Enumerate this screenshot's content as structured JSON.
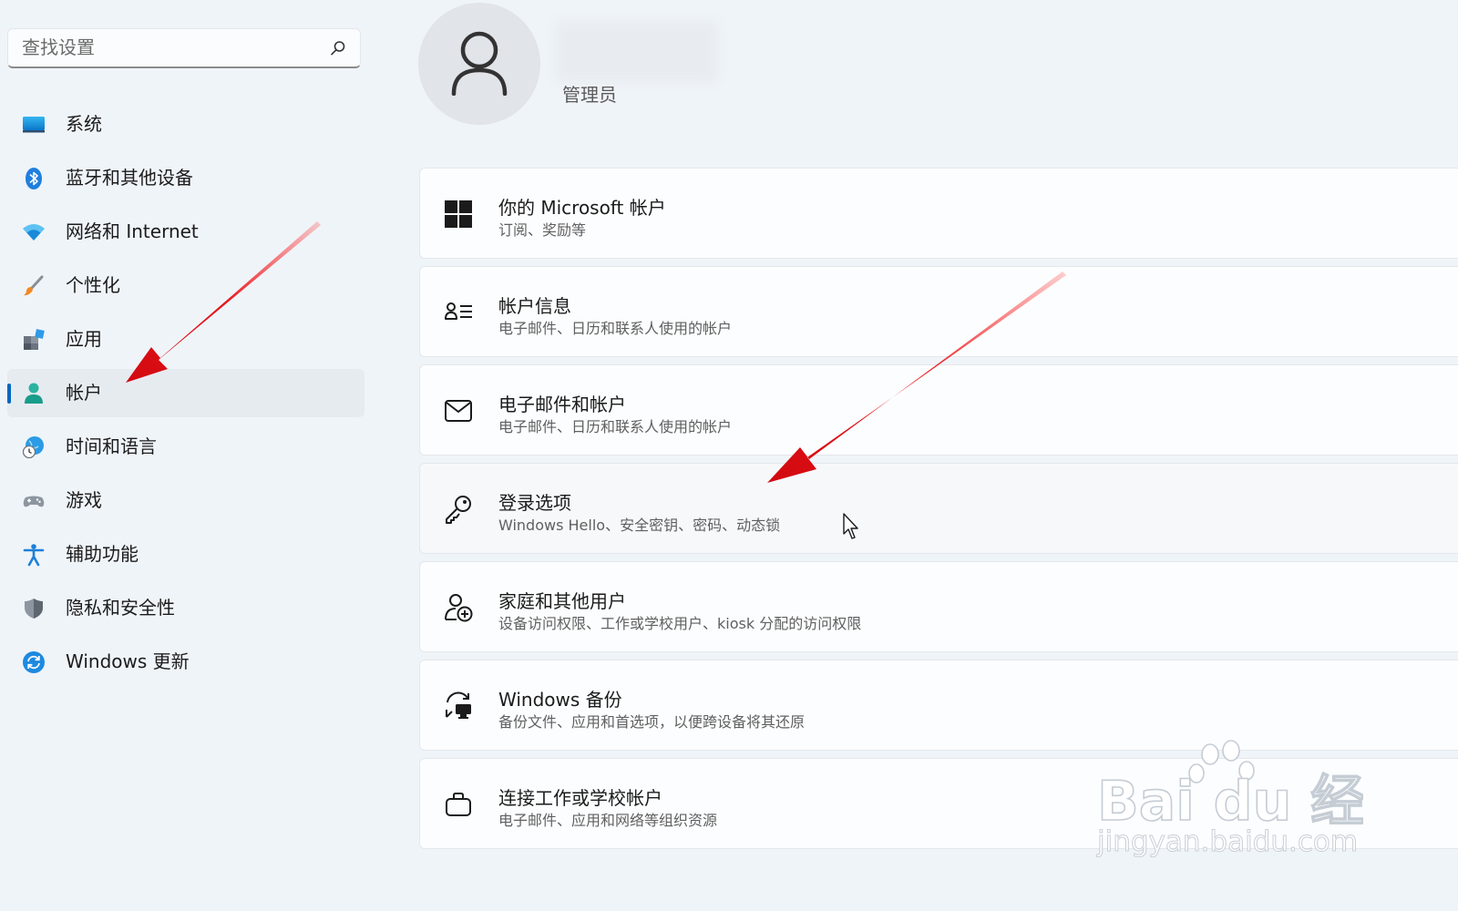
{
  "search": {
    "placeholder": "查找设置",
    "icon": "search-icon"
  },
  "sidebar": {
    "active_index": 5,
    "accent": "#0067c0",
    "items": [
      {
        "label": "系统",
        "icon": "monitor-icon"
      },
      {
        "label": "蓝牙和其他设备",
        "icon": "bluetooth-icon"
      },
      {
        "label": "网络和 Internet",
        "icon": "wifi-icon"
      },
      {
        "label": "个性化",
        "icon": "brush-icon"
      },
      {
        "label": "应用",
        "icon": "apps-icon"
      },
      {
        "label": "帐户",
        "icon": "person-icon"
      },
      {
        "label": "时间和语言",
        "icon": "globe-clock-icon"
      },
      {
        "label": "游戏",
        "icon": "gamepad-icon"
      },
      {
        "label": "辅助功能",
        "icon": "accessibility-icon"
      },
      {
        "label": "隐私和安全性",
        "icon": "shield-icon"
      },
      {
        "label": "Windows 更新",
        "icon": "update-icon"
      }
    ]
  },
  "profile": {
    "role": "管理员",
    "avatar_icon": "user-avatar-icon"
  },
  "cards": [
    {
      "title": "你的 Microsoft 帐户",
      "subtitle": "订阅、奖励等",
      "icon": "windows-logo-icon"
    },
    {
      "title": "帐户信息",
      "subtitle": "电子邮件、日历和联系人使用的帐户",
      "icon": "account-info-icon"
    },
    {
      "title": "电子邮件和帐户",
      "subtitle": "电子邮件、日历和联系人使用的帐户",
      "icon": "mail-icon"
    },
    {
      "title": "登录选项",
      "subtitle": "Windows Hello、安全密钥、密码、动态锁",
      "icon": "key-icon"
    },
    {
      "title": "家庭和其他用户",
      "subtitle": "设备访问权限、工作或学校用户、kiosk 分配的访问权限",
      "icon": "add-person-icon"
    },
    {
      "title": "Windows 备份",
      "subtitle": "备份文件、应用和首选项，以便跨设备将其还原",
      "icon": "backup-icon"
    },
    {
      "title": "连接工作或学校帐户",
      "subtitle": "电子邮件、应用和网络等组织资源",
      "icon": "briefcase-icon"
    }
  ],
  "hovered_card_index": 3,
  "watermark": {
    "brand": "Bai du 经验",
    "url": "jingyan.baidu.com"
  },
  "colors": {
    "annotation_arrow": "#e8141a",
    "window_bg": "#eff4f9"
  }
}
